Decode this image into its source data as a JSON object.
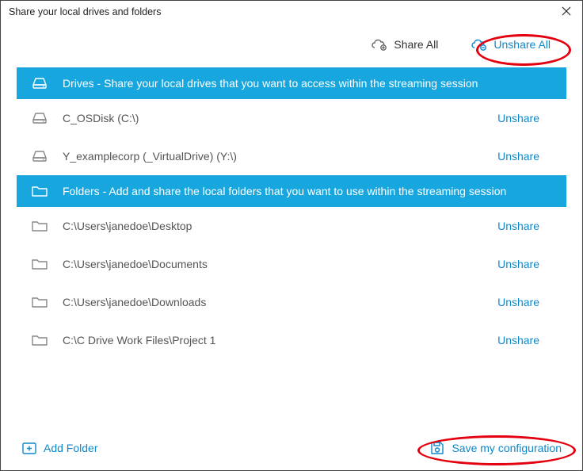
{
  "titlebar": {
    "title": "Share your local drives and folders"
  },
  "actions": {
    "share_all": "Share All",
    "unshare_all": "Unshare All"
  },
  "drives": {
    "header": "Drives - Share your local drives that you want to access within the streaming session",
    "items": [
      {
        "label": "C_OSDisk (C:\\)",
        "action": "Unshare"
      },
      {
        "label": "Y_examplecorp (_VirtualDrive) (Y:\\)",
        "action": "Unshare"
      }
    ]
  },
  "folders": {
    "header": "Folders - Add and share the local folders that you want to use within the streaming session",
    "items": [
      {
        "label": "C:\\Users\\janedoe\\Desktop",
        "action": "Unshare"
      },
      {
        "label": "C:\\Users\\janedoe\\Documents",
        "action": "Unshare"
      },
      {
        "label": "C:\\Users\\janedoe\\Downloads",
        "action": "Unshare"
      },
      {
        "label": "C:\\C Drive Work Files\\Project 1",
        "action": "Unshare"
      }
    ]
  },
  "footer": {
    "add_folder": "Add Folder",
    "save": "Save my configuration"
  },
  "colors": {
    "accent": "#18A6DF",
    "link": "#0E88C9",
    "annotation": "#E3000F"
  }
}
